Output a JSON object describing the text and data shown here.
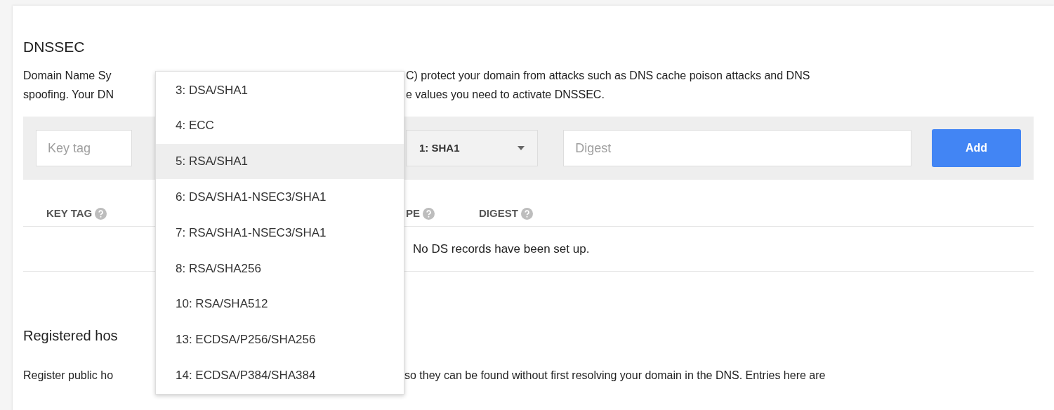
{
  "section_title": "DNSSEC",
  "description_lines": [
    {
      "left": "Domain Name Sy",
      "right": "C) protect your domain from attacks such as DNS cache poison attacks and DNS"
    },
    {
      "left": "spoofing. Your DN",
      "right": "e values you need to activate DNSSEC."
    }
  ],
  "form": {
    "key_tag": {
      "placeholder": "Key tag"
    },
    "digest_type": {
      "value": "1: SHA1"
    },
    "digest": {
      "placeholder": "Digest"
    },
    "add_button": "Add"
  },
  "table": {
    "columns": [
      {
        "label": "KEY TAG",
        "help": true
      },
      {
        "label": "PE",
        "help": true
      },
      {
        "label": "DIGEST",
        "help": true
      }
    ],
    "empty_message": "No DS records have been set up."
  },
  "hosts": {
    "title": "Registered hos",
    "description": {
      "left": "Register public ho",
      "right": "so they can be found without first resolving your domain in the DNS. Entries here are"
    }
  },
  "algorithm_menu": [
    {
      "label": "3: DSA/SHA1",
      "selected": false
    },
    {
      "label": "4: ECC",
      "selected": false
    },
    {
      "label": "5: RSA/SHA1",
      "selected": true
    },
    {
      "label": "6: DSA/SHA1-NSEC3/SHA1",
      "selected": false
    },
    {
      "label": "7: RSA/SHA1-NSEC3/SHA1",
      "selected": false
    },
    {
      "label": "8: RSA/SHA256",
      "selected": false
    },
    {
      "label": "10: RSA/SHA512",
      "selected": false
    },
    {
      "label": "13: ECDSA/P256/SHA256",
      "selected": false
    },
    {
      "label": "14: ECDSA/P384/SHA384",
      "selected": false
    }
  ]
}
